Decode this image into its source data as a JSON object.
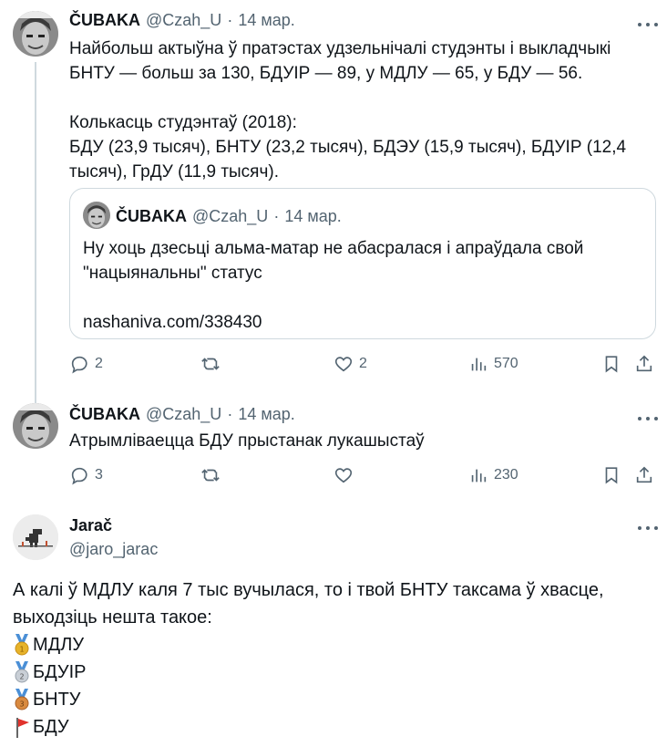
{
  "tweet1": {
    "name": "ČUBAKA",
    "handle": "@Czah_U",
    "separator": "·",
    "date": "14 мар.",
    "text_lines": [
      "Найбольш актыўна ў пратэстах удзельнічалі студэнты і выкладчыкі",
      "БНТУ — больш за 130, БДУІР — 89, у МДЛУ — 65, у БДУ — 56.",
      "Колькасць студэнтаў (2018):",
      "БДУ (23,9 тысяч), БНТУ (23,2 тысяч), БДЭУ (15,9 тысяч), БДУІР (12,4",
      "тысяч), ГрДУ (11,9 тысяч)."
    ],
    "quote": {
      "name": "ČUBAKA",
      "handle": "@Czah_U",
      "separator": "·",
      "date": "14 мар.",
      "text_lines": [
        "Ну хоць дзесьці альма-матар не абасралася і апраўдала свой",
        "\"нацыянальны\" статус"
      ],
      "link": "nashaniva.com/338430"
    },
    "actions": {
      "replies": "2",
      "likes": "2",
      "views": "570"
    }
  },
  "tweet2": {
    "name": "ČUBAKA",
    "handle": "@Czah_U",
    "separator": "·",
    "date": "14 мар.",
    "text": "Атрымліваецца БДУ прыстанак лукашыстаў",
    "actions": {
      "replies": "3",
      "views": "230"
    }
  },
  "tweet3": {
    "name": "Jarač",
    "handle": "@jaro_jarac",
    "text_lines": [
      "А калі ў МДЛУ каля 7 тыс вучылася, то і твой БНТУ таксама ў хвасце,",
      "выходзіць нешта такое:"
    ],
    "ranking": [
      {
        "icon": "gold-medal-icon",
        "label": "МДЛУ"
      },
      {
        "icon": "silver-medal-icon",
        "label": "БДУІР"
      },
      {
        "icon": "bronze-medal-icon",
        "label": "БНТУ"
      },
      {
        "icon": "red-flag-icon",
        "label": "БДУ"
      }
    ]
  },
  "colors": {
    "text": "#0f1419",
    "secondary": "#536471",
    "border": "#cfd9de"
  }
}
